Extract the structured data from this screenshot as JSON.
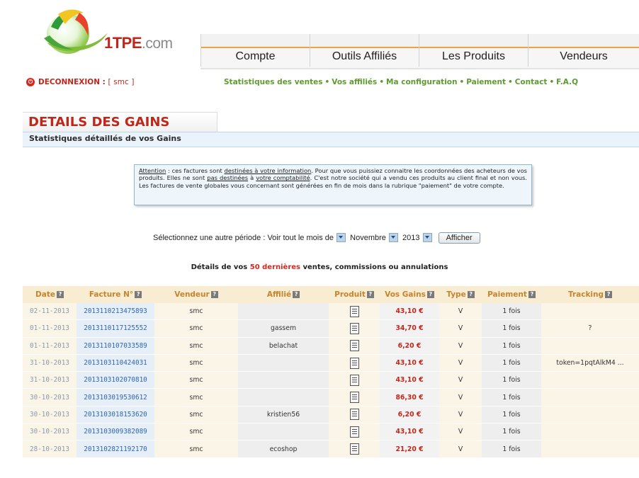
{
  "brand": {
    "name": "1TPE",
    "domain": ".com"
  },
  "nav": {
    "items": [
      "Compte",
      "Outils Affiliés",
      "Les Produits",
      "Vendeurs"
    ]
  },
  "session": {
    "logout_label": "DECONNEXION :",
    "user_open": "[",
    "user": "smc",
    "user_close": "]"
  },
  "sublinks": [
    "Statistiques des ventes",
    "Vos affiliés",
    "Ma configuration",
    "Paiement",
    "Contact",
    "F.A.Q"
  ],
  "page": {
    "title": "DETAILS DES GAINS",
    "subtitle": "Statistiques détaillés de vos Gains"
  },
  "notice": {
    "t1": "Attention",
    "t2": " : ces factures sont ",
    "t3": "destinées à votre information",
    "t4": ". Pour que vous puissiez connaitre les coordonnées des acheteurs de vos produits. Elles ne sont ",
    "t5": "pas destinées",
    "t6": " à ",
    "t7": "votre comptabilité",
    "t8": ". C'est notre société qui a vendu ces produits au client final et non vous. Les factures de vente globales vous concernant sont générées en fin de mois dans la rubrique \"paiement\" de votre compte."
  },
  "period": {
    "label": "Sélectionnez une autre période :",
    "view_label": "Voir tout le mois de",
    "month": "Novembre",
    "year": "2013",
    "button": "Afficher"
  },
  "details": {
    "prefix": "Détails de vos",
    "highlight": "50 dernières",
    "suffix": "ventes, commissions ou annulations"
  },
  "table": {
    "headers": [
      "Date",
      "Facture N°",
      "Vendeur",
      "Affilié",
      "Produit",
      "Vos Gains",
      "Type",
      "Paiement",
      "Tracking"
    ],
    "help_glyph": "?",
    "rows": [
      {
        "date": "02-11-2013",
        "facture": "2013110213475893",
        "vendeur": "smc",
        "affilie": "",
        "gains": "43,10 €",
        "type": "V",
        "paiement": "1 fois",
        "tracking": ""
      },
      {
        "date": "01-11-2013",
        "facture": "2013110117125552",
        "vendeur": "smc",
        "affilie": "gassem",
        "gains": "34,70 €",
        "type": "V",
        "paiement": "1 fois",
        "tracking": "?"
      },
      {
        "date": "01-11-2013",
        "facture": "2013110107033589",
        "vendeur": "smc",
        "affilie": "belachat",
        "gains": "6,20 €",
        "type": "V",
        "paiement": "1 fois",
        "tracking": ""
      },
      {
        "date": "31-10-2013",
        "facture": "2013103110424031",
        "vendeur": "smc",
        "affilie": "",
        "gains": "43,10 €",
        "type": "V",
        "paiement": "1 fois",
        "tracking": "token=1pqtAlkM4 ..."
      },
      {
        "date": "31-10-2013",
        "facture": "2013103102070810",
        "vendeur": "smc",
        "affilie": "",
        "gains": "43,10 €",
        "type": "V",
        "paiement": "1 fois",
        "tracking": ""
      },
      {
        "date": "30-10-2013",
        "facture": "2013103019530612",
        "vendeur": "smc",
        "affilie": "",
        "gains": "86,30 €",
        "type": "V",
        "paiement": "1 fois",
        "tracking": ""
      },
      {
        "date": "30-10-2013",
        "facture": "2013103018153620",
        "vendeur": "smc",
        "affilie": "kristien56",
        "gains": "6,20 €",
        "type": "V",
        "paiement": "1 fois",
        "tracking": ""
      },
      {
        "date": "30-10-2013",
        "facture": "2013103009382089",
        "vendeur": "smc",
        "affilie": "",
        "gains": "43,10 €",
        "type": "V",
        "paiement": "1 fois",
        "tracking": ""
      },
      {
        "date": "28-10-2013",
        "facture": "2013102821192170",
        "vendeur": "smc",
        "affilie": "ecoshop",
        "gains": "21,20 €",
        "type": "V",
        "paiement": "1 fois",
        "tracking": ""
      }
    ]
  }
}
